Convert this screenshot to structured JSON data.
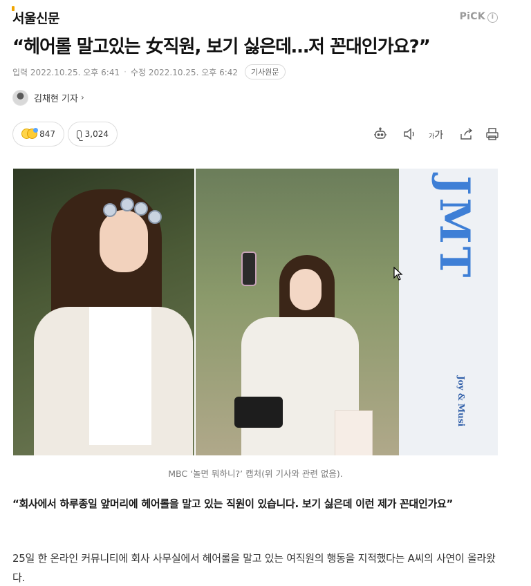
{
  "header": {
    "publisher": "서울신문",
    "pick_label": "PiCK",
    "pick_info": "i"
  },
  "article": {
    "title": "“헤어롤 말고있는 女직원, 보기 싫은데…저 꼰대인가요?”",
    "input_label": "입력",
    "input_time": "2022.10.25. 오후 6:41",
    "modified_label": "수정",
    "modified_time": "2022.10.25. 오후 6:42",
    "original_link": "기사원문",
    "author": "김채현 기자",
    "author_chevron": "›"
  },
  "actions": {
    "reaction_count": "847",
    "comment_count": "3,024",
    "fontsize_small": "가",
    "fontsize_large": "가"
  },
  "photo": {
    "caption": "MBC ‘놀면 뭐하니?’ 캡처(위 기사와 관련 없음).",
    "sign_text": "JMT",
    "sign_sub": "Joy & Musi"
  },
  "content": {
    "lead": "“회사에서 하루종일 앞머리에 헤어롤을 말고 있는 직원이 있습니다. 보기 싫은데 이런 제가 꼰대인가요”",
    "paragraph_1": "25일 한 온라인 커뮤니티에 회사 사무실에서 헤어롤을 말고 있는 여직원의 행동을 지적했다는 A씨의 사연이 올라왔다."
  },
  "colors": {
    "accent_logo": "#f0a500",
    "sign_blue": "#3e7fd6"
  }
}
